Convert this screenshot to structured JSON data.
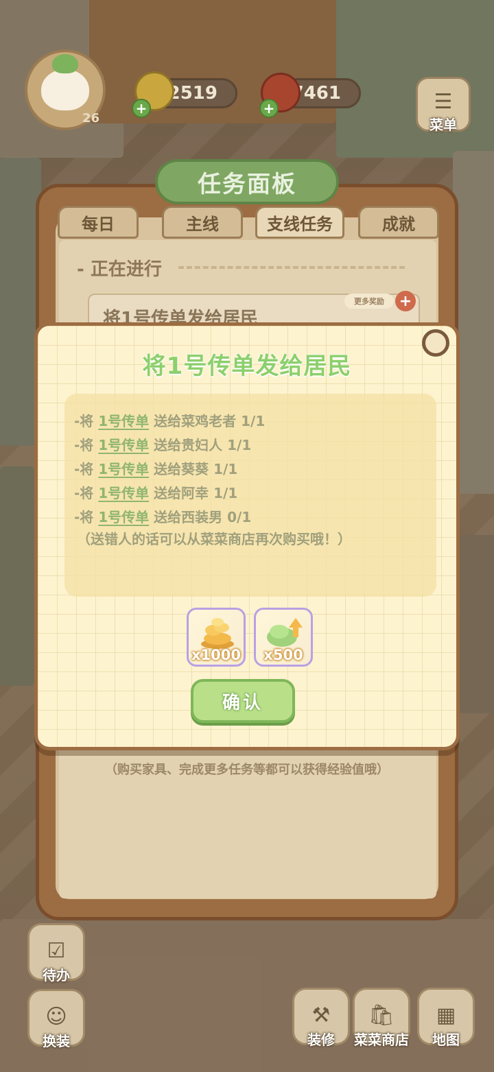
{
  "hud": {
    "level": "26",
    "coins": "2519",
    "tomatoes": "7461",
    "menu_label": "菜单"
  },
  "board": {
    "title": "任务面板",
    "tabs": [
      "每日",
      "主线",
      "支线任务",
      "成就"
    ],
    "active_tab": "支线任务",
    "in_progress_label": "- 正在进行",
    "task_card_title": "将1号传单发给居民",
    "more_reward_label": "更多奖励",
    "exp_note": "（购买家具、完成更多任务等都可以获得经验值哦）"
  },
  "modal": {
    "title": "将1号传单发给居民",
    "requirements": [
      {
        "prefix": "-将 ",
        "item": "1号传单",
        "text": " 送给菜鸡老者 1/1"
      },
      {
        "prefix": "-将 ",
        "item": "1号传单",
        "text": " 送给贵妇人 1/1"
      },
      {
        "prefix": "-将 ",
        "item": "1号传单",
        "text": " 送给葵葵 1/1"
      },
      {
        "prefix": "-将 ",
        "item": "1号传单",
        "text": " 送给阿幸 1/1"
      },
      {
        "prefix": "-将 ",
        "item": "1号传单",
        "text": " 送给西装男 0/1"
      }
    ],
    "note": "（送错人的话可以从菜菜商店再次购买哦！）",
    "rewards": [
      {
        "icon": "gold-coins-icon",
        "qty": "x1000"
      },
      {
        "icon": "exp-leaf-icon",
        "qty": "x500"
      }
    ],
    "confirm_label": "确认"
  },
  "bottom_nav": {
    "todo": "待办",
    "dress": "换装",
    "decorate": "装修",
    "shop": "菜菜商店",
    "map": "地图"
  },
  "colors": {
    "modal_bg": "#fdf3cf",
    "title_green": "#8ccf6c",
    "confirm_green": "#b9e089",
    "board_brown": "#9c6c42"
  }
}
